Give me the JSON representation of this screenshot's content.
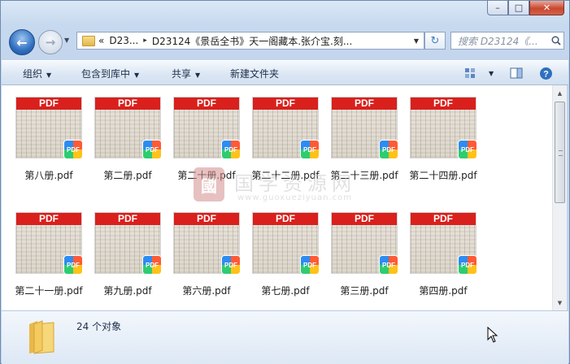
{
  "window": {
    "caption": {
      "minimize": "–",
      "maximize": "□",
      "close": "✕"
    }
  },
  "nav": {
    "back_icon": "back-arrow-icon",
    "forward_icon": "forward-arrow-icon",
    "back_glyph": "←",
    "forward_glyph": "→",
    "history_dropdown": "▼"
  },
  "address": {
    "overflow": "«",
    "crumbs": [
      "D23...",
      "D23124《景岳全书》天一阁藏本.张介宝.刻..."
    ],
    "separator": "▸",
    "dropdown": "▼",
    "refresh_glyph": "↻"
  },
  "search": {
    "placeholder": "搜索 D23124《...",
    "icon": "🔍"
  },
  "toolbar": {
    "organize": "组织",
    "include_in_library": "包含到库中",
    "share": "共享",
    "new_folder": "新建文件夹",
    "dropdown": "▼"
  },
  "files": [
    {
      "name": "第八册.pdf"
    },
    {
      "name": "第二册.pdf"
    },
    {
      "name": "第二十册.pdf"
    },
    {
      "name": "第二十二册.pdf"
    },
    {
      "name": "第二十三册.pdf"
    },
    {
      "name": "第二十四册.pdf"
    },
    {
      "name": "第二十一册.pdf"
    },
    {
      "name": "第九册.pdf"
    },
    {
      "name": "第六册.pdf"
    },
    {
      "name": "第七册.pdf"
    },
    {
      "name": "第三册.pdf"
    },
    {
      "name": "第四册.pdf"
    }
  ],
  "thumb": {
    "banner": "PDF",
    "badge": "PDF"
  },
  "watermark": {
    "seal": "國",
    "title": "国学资源网",
    "url": "www.guoxueziyuan.com"
  },
  "status": {
    "count_text": "24 个对象"
  },
  "colors": {
    "pdf_red": "#d9201c",
    "accent_blue": "#2f6fc0"
  }
}
